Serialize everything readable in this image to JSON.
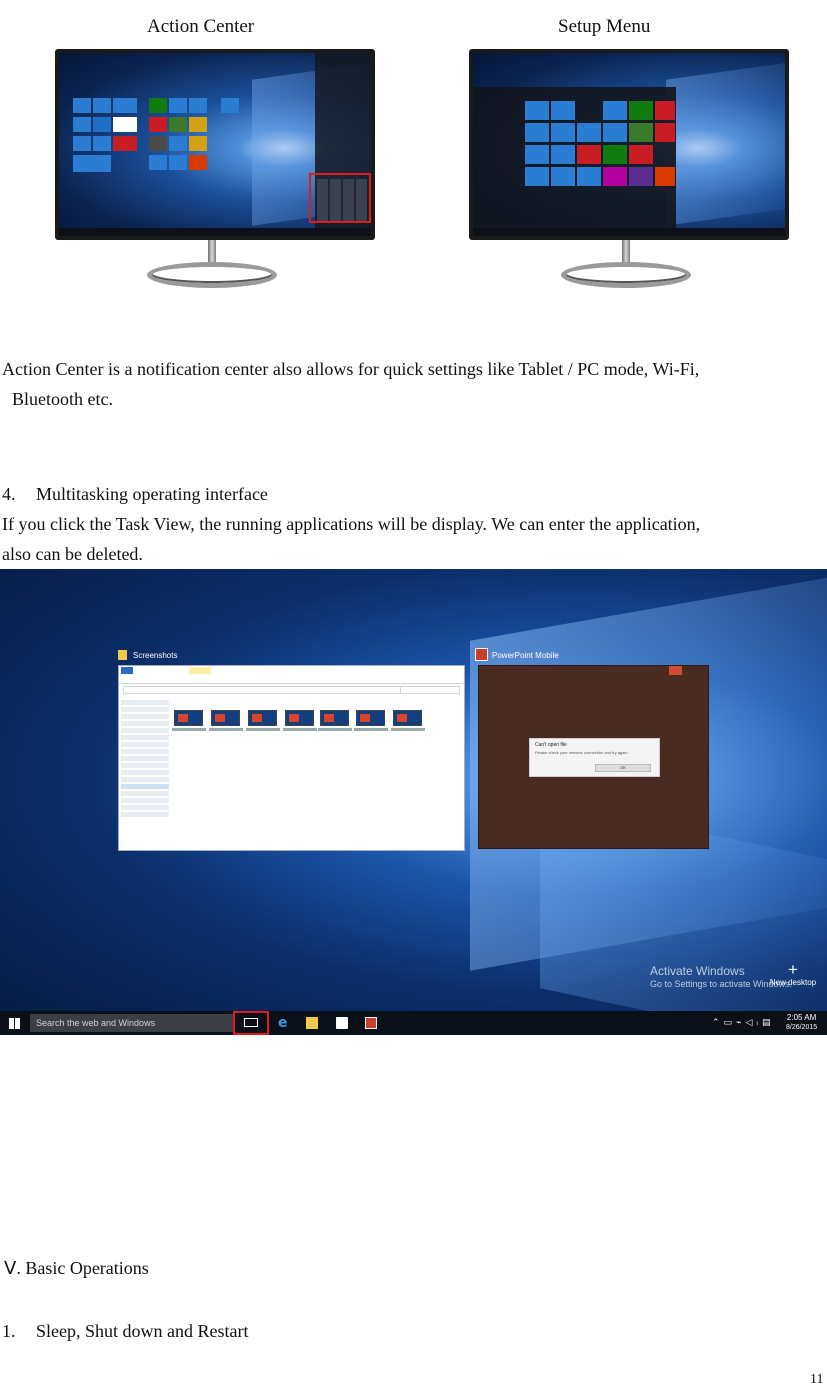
{
  "figure_top": {
    "left_caption": "Action Center",
    "right_caption": "Setup Menu"
  },
  "section3": {
    "paragraph_line1": "Action Center is a notification center also allows for quick settings like Tablet / PC mode, Wi-Fi,",
    "paragraph_line2": "Bluetooth etc."
  },
  "section4": {
    "number": "4.",
    "heading": "Multitasking operating interface",
    "paragraph_line1": "If you click the Task View, the running applications will be display. We can enter the application,",
    "paragraph_line2": "also can be deleted."
  },
  "screenshot": {
    "explorer_title": "Screenshots",
    "ppt_title": "PowerPoint Mobile",
    "dialog_title": "Can't open file",
    "dialog_text": "Please check your network connection and try again.",
    "dialog_button": "OK",
    "watermark_line1": "Activate Windows",
    "watermark_line2": "Go to Settings to activate Windows.",
    "new_desktop": "New desktop",
    "new_desktop_symbol": "+",
    "search_placeholder": "Search the web and Windows",
    "clock_time": "2:05 AM",
    "clock_date": "8/26/2015",
    "colors": {
      "highlight": "#e01b1b",
      "accent": "#2b6cc4",
      "ppt_red": "#c8402b"
    }
  },
  "section5": {
    "numeral": "Ⅴ.",
    "heading": "Basic Operations"
  },
  "subsection1": {
    "number": "1.",
    "heading": "Sleep, Shut down and Restart"
  },
  "page_number": "11"
}
